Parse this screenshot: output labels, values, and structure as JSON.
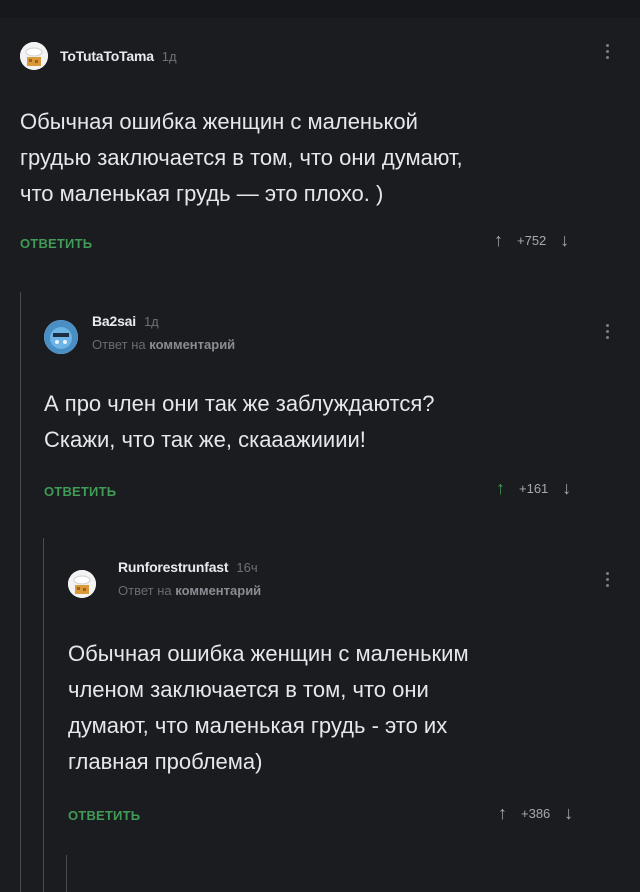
{
  "comments": [
    {
      "username": "ToTutaToTama",
      "time": "1д",
      "reply_to": "",
      "text_lines": [
        "Обычная ошибка женщин с маленькой",
        "грудью заключается в том, что они думают,",
        "что маленькая грудь — это плохо. )"
      ],
      "reply_label": "ОТВЕТИТЬ",
      "rating": "+752"
    },
    {
      "username": "Ba2sai",
      "time": "1д",
      "reply_to_prefix": "Ответ на",
      "reply_to_target": "комментарий",
      "text_lines": [
        "А про член они так же заблуждаются?",
        "Скажи,  что так же, скааажииии!"
      ],
      "reply_label": "ОТВЕТИТЬ",
      "rating": "+161"
    },
    {
      "username": "Runforestrunfast",
      "time": "16ч",
      "reply_to_prefix": "Ответ на",
      "reply_to_target": "комментарий",
      "text_lines": [
        "Обычная ошибка женщин с маленьким",
        "членом заключается в том, что они",
        "думают, что маленькая грудь - это их",
        "главная проблема)"
      ],
      "reply_label": "ОТВЕТИТЬ",
      "rating": "+386"
    }
  ],
  "colors": {
    "background": "#1b1c20",
    "accent_green": "#3f9b55",
    "muted": "#6f7077"
  },
  "icons": {
    "up": "arrow-up-icon",
    "down": "arrow-down-icon",
    "menu": "kebab-menu-icon"
  }
}
